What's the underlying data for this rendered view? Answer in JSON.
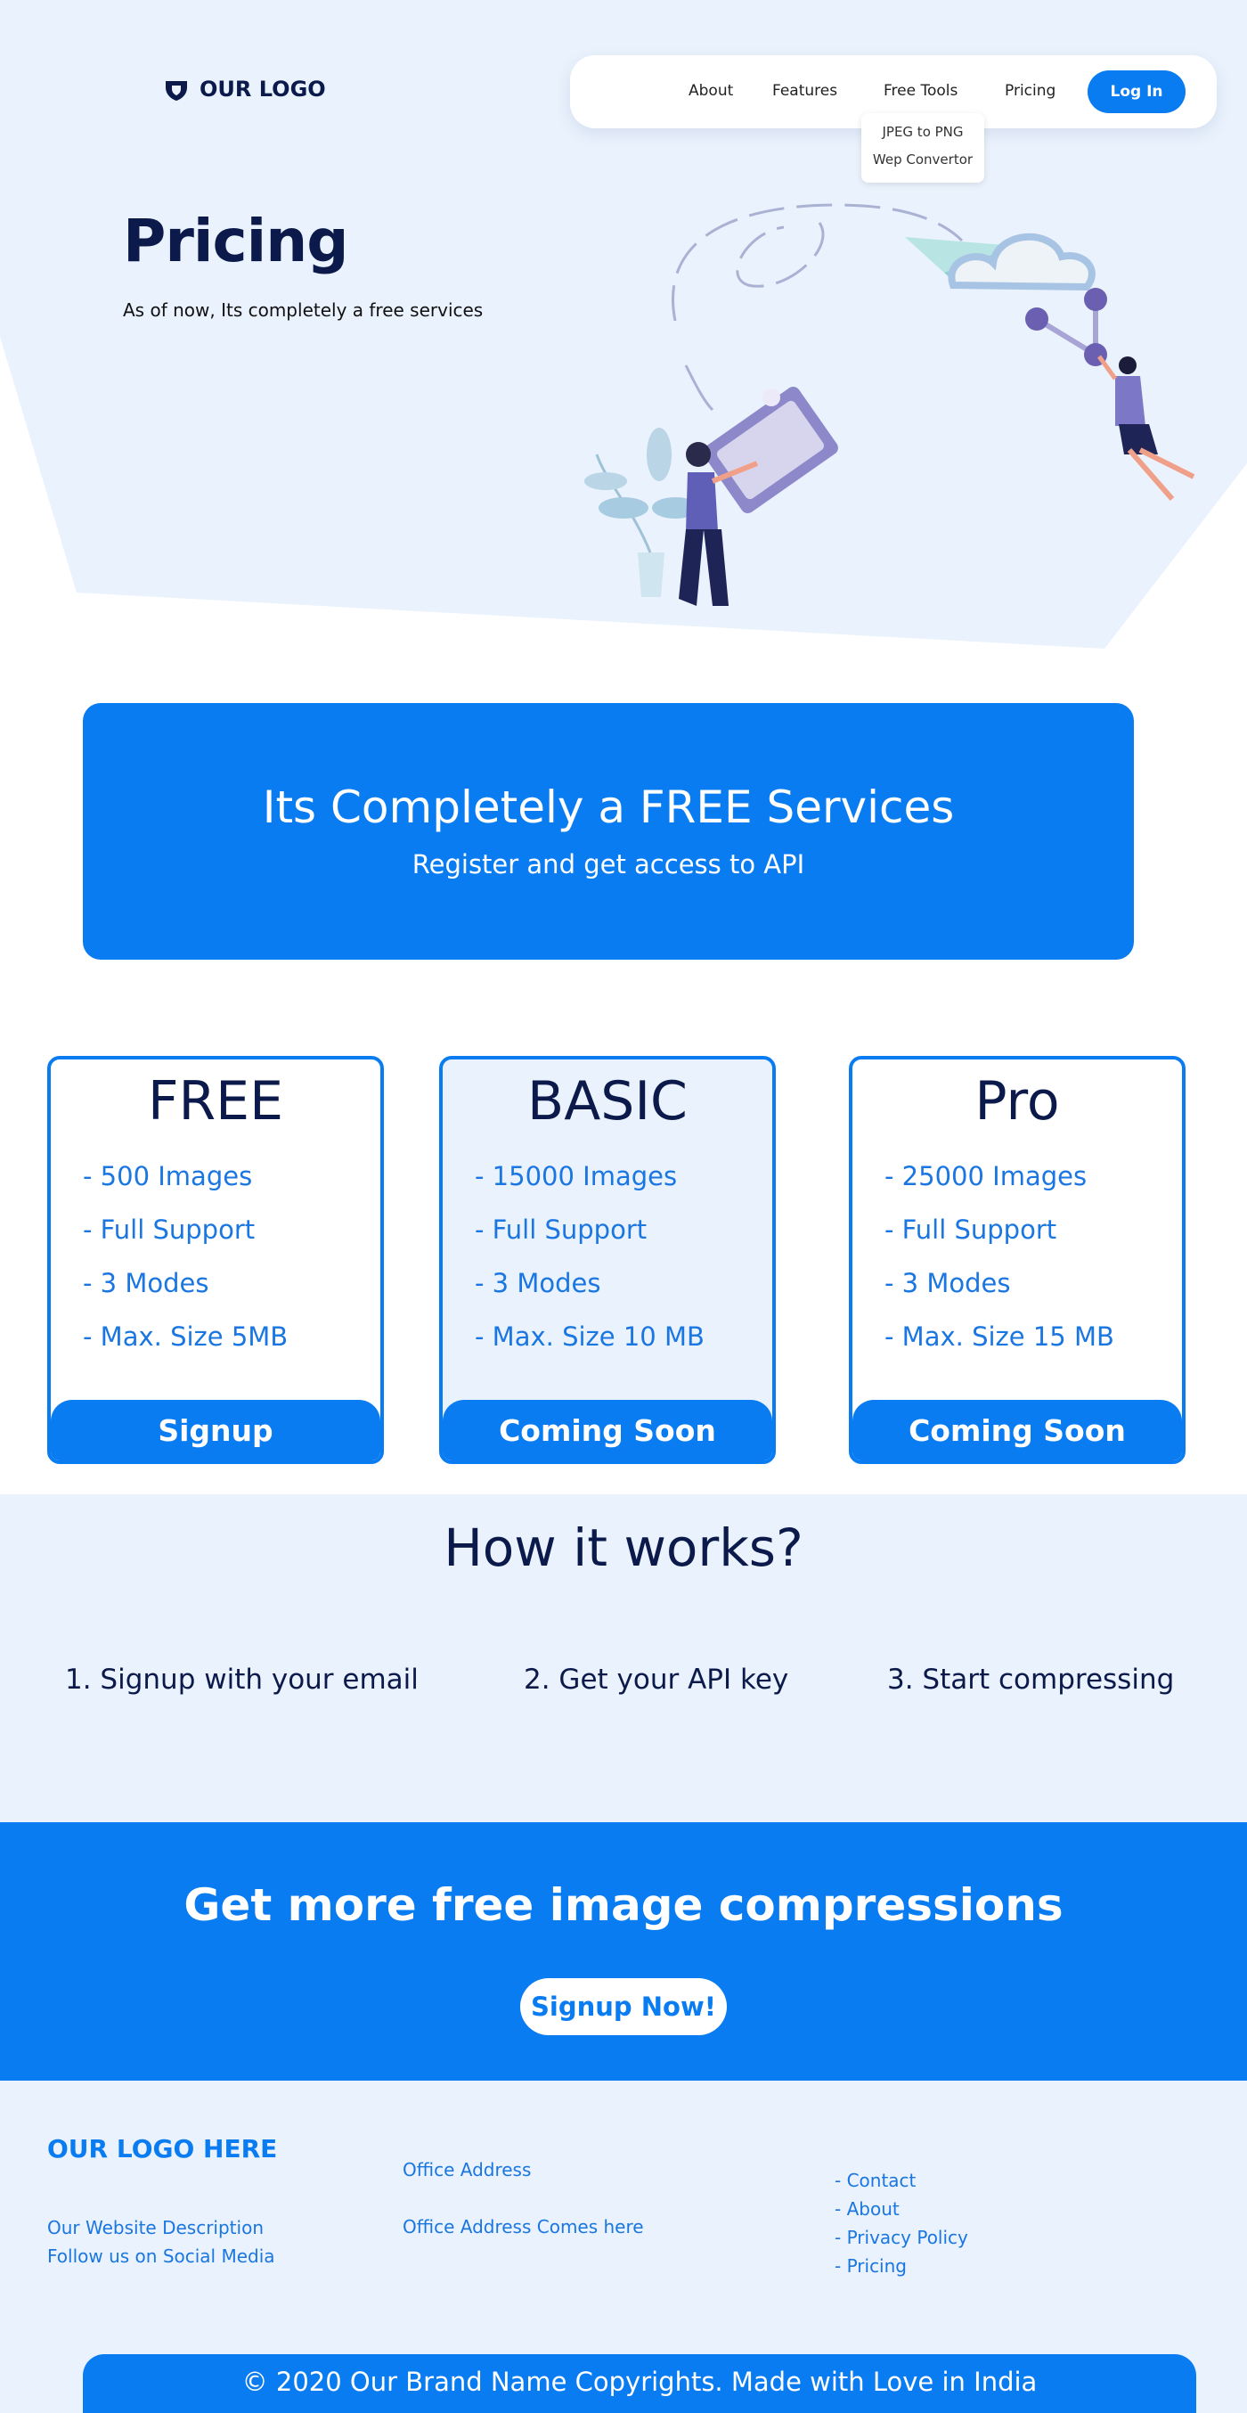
{
  "brand": {
    "logo_text": "OUR LOGO",
    "accent": "#0a7cf2",
    "navy": "#0b1a4a"
  },
  "nav": {
    "items": [
      {
        "label": "About"
      },
      {
        "label": "Features"
      },
      {
        "label": "Free Tools"
      },
      {
        "label": "Pricing"
      }
    ],
    "login_label": "Log In",
    "dropdown": [
      "JPEG to PNG",
      "Wep Convertor"
    ]
  },
  "hero": {
    "title": "Pricing",
    "subtitle": "As of now, Its completely a free services"
  },
  "banner": {
    "title": "Its Completely a FREE Services",
    "subtitle": "Register and get access to API"
  },
  "plans": [
    {
      "name": "FREE",
      "features": [
        "- 500 Images",
        "- Full Support",
        "- 3 Modes",
        "- Max. Size 5MB"
      ],
      "button": "Signup"
    },
    {
      "name": "BASIC",
      "features": [
        "- 15000 Images",
        "- Full Support",
        "- 3 Modes",
        "- Max. Size 10 MB"
      ],
      "button": "Coming Soon"
    },
    {
      "name": "Pro",
      "features": [
        "- 25000 Images",
        "- Full Support",
        "- 3 Modes",
        "- Max. Size 15 MB"
      ],
      "button": "Coming Soon"
    }
  ],
  "how": {
    "title": "How it works?",
    "steps": [
      "1. Signup with your email",
      "2. Get your API key",
      "3. Start compressing"
    ]
  },
  "cta": {
    "title": "Get more free image compressions",
    "button": "Signup Now!"
  },
  "footer": {
    "logo": "OUR LOGO HERE",
    "description": "Our Website Description",
    "social": "Follow us on Social Media",
    "office_label": "Office Address",
    "office_value": "Office Address Comes here",
    "links": [
      "- Contact",
      "- About",
      "- Privacy Policy",
      "- Pricing"
    ],
    "copyright": "© 2020 Our Brand Name Copyrights. Made with Love in India"
  }
}
